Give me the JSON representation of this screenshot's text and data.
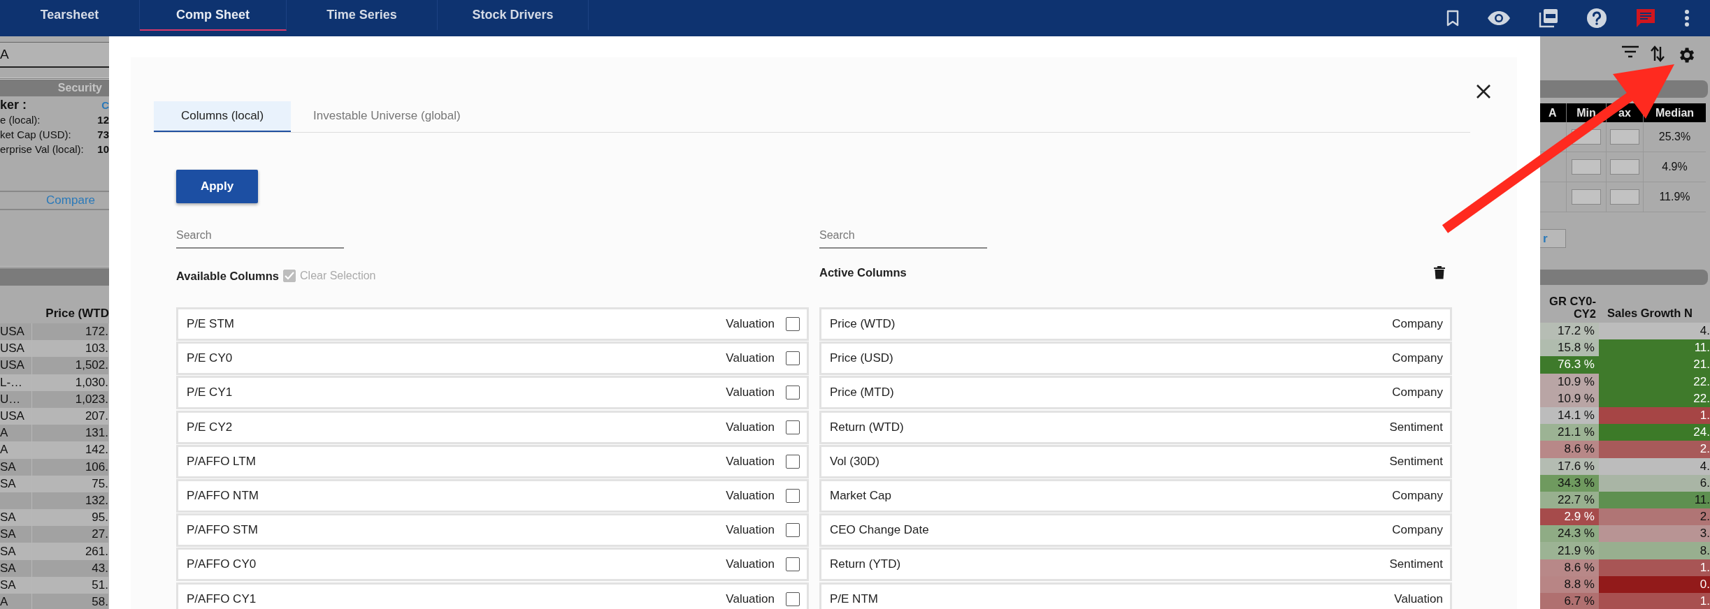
{
  "nav": {
    "tabs": [
      {
        "label": "Tearsheet",
        "selected": false
      },
      {
        "label": "Comp Sheet",
        "selected": true
      },
      {
        "label": "Time Series",
        "selected": false
      },
      {
        "label": "Stock Drivers",
        "selected": false
      }
    ]
  },
  "background_left": {
    "field_value": "A",
    "section_title": "Security",
    "info": [
      {
        "label": "ker :",
        "value": "C",
        "kind": "link"
      },
      {
        "label": "e (local):",
        "value": "12",
        "kind": "plain"
      },
      {
        "label": "ket Cap (USD):",
        "value": "73",
        "kind": "plain"
      },
      {
        "label": "erprise Val (local):",
        "value": "10",
        "kind": "plain"
      }
    ],
    "compare_link": "Compare",
    "column_header": "Price (WTD",
    "rows": [
      [
        "USA",
        "172."
      ],
      [
        "USA",
        "103."
      ],
      [
        "USA",
        "1,502."
      ],
      [
        "L-…",
        "1,030."
      ],
      [
        "U…",
        "1,023."
      ],
      [
        "USA",
        "207."
      ],
      [
        "A",
        "131."
      ],
      [
        "A",
        "142."
      ],
      [
        "SA",
        "106."
      ],
      [
        "SA",
        "75."
      ],
      [
        "",
        "132."
      ],
      [
        "SA",
        "95."
      ],
      [
        "SA",
        "27."
      ],
      [
        "SA",
        "261."
      ],
      [
        "SA",
        "43."
      ],
      [
        "SA",
        "51."
      ],
      [
        "A",
        "58."
      ]
    ]
  },
  "background_right": {
    "stats_columns": [
      "A",
      "Min",
      "ax",
      "Median"
    ],
    "stats_medians": [
      "25.3%",
      "4.9%",
      "11.9%"
    ],
    "button_label": "r",
    "columns": [
      "GR CY0- CY2",
      "Sales Growth N"
    ],
    "rows": [
      {
        "growth": {
          "text": "17.2 %",
          "color": "#b6bdb4"
        },
        "sales": {
          "text": "4.",
          "color": "#bcbcbc"
        }
      },
      {
        "growth": {
          "text": "15.8 %",
          "color": "#b0bcae"
        },
        "sales": {
          "text": "11.",
          "color": "#3f7a2b"
        }
      },
      {
        "growth": {
          "text": "76.3 %",
          "color": "#3e7a2b"
        },
        "sales": {
          "text": "21.",
          "color": "#3f7a2b"
        }
      },
      {
        "growth": {
          "text": "10.9 %",
          "color": "#b9a5a5"
        },
        "sales": {
          "text": "22.",
          "color": "#3f7a2b"
        }
      },
      {
        "growth": {
          "text": "10.9 %",
          "color": "#b9a5a5"
        },
        "sales": {
          "text": "22.",
          "color": "#3f7a2b"
        }
      },
      {
        "growth": {
          "text": "14.1 %",
          "color": "#bcbcbc"
        },
        "sales": {
          "text": "1.",
          "color": "#a64545"
        }
      },
      {
        "growth": {
          "text": "21.1 %",
          "color": "#9cb394"
        },
        "sales": {
          "text": "24.",
          "color": "#3c7a28"
        }
      },
      {
        "growth": {
          "text": "8.6 %",
          "color": "#b88888"
        },
        "sales": {
          "text": "2.",
          "color": "#a85a5a"
        }
      },
      {
        "growth": {
          "text": "17.6 %",
          "color": "#b4bcb2"
        },
        "sales": {
          "text": "4.",
          "color": "#bcbcbc"
        }
      },
      {
        "growth": {
          "text": "34.3 %",
          "color": "#6f9a5f"
        },
        "sales": {
          "text": "6.",
          "color": "#a9b5a5"
        }
      },
      {
        "growth": {
          "text": "22.7 %",
          "color": "#98b08f"
        },
        "sales": {
          "text": "11.",
          "color": "#5e9050"
        }
      },
      {
        "growth": {
          "text": "2.9 %",
          "color": "#a64b4b"
        },
        "sales": {
          "text": "2.",
          "color": "#b07575"
        }
      },
      {
        "growth": {
          "text": "24.3 %",
          "color": "#8fac85"
        },
        "sales": {
          "text": "3.",
          "color": "#b89494"
        }
      },
      {
        "growth": {
          "text": "21.9 %",
          "color": "#9cb394"
        },
        "sales": {
          "text": "8.",
          "color": "#98af8f"
        }
      },
      {
        "growth": {
          "text": "8.6 %",
          "color": "#b88888"
        },
        "sales": {
          "text": "1.",
          "color": "#a85555"
        }
      },
      {
        "growth": {
          "text": "8.8 %",
          "color": "#b88585"
        },
        "sales": {
          "text": "0.",
          "color": "#921a1a"
        }
      },
      {
        "growth": {
          "text": "6.7 %",
          "color": "#b07070"
        },
        "sales": {
          "text": "1.",
          "color": "#a85050"
        }
      }
    ]
  },
  "modal": {
    "tabs": [
      {
        "label": "Columns (local)",
        "selected": true
      },
      {
        "label": "Investable Universe (global)",
        "selected": false
      }
    ],
    "apply_label": "Apply",
    "available": {
      "search_placeholder": "Search",
      "title": "Available Columns",
      "select_all": {
        "checked": true,
        "disabled": true
      },
      "clear_selection": {
        "label": "Clear Selection",
        "disabled": true
      },
      "items": [
        {
          "name": "P/E STM",
          "category": "Valuation",
          "checked": false
        },
        {
          "name": "P/E CY0",
          "category": "Valuation",
          "checked": false
        },
        {
          "name": "P/E CY1",
          "category": "Valuation",
          "checked": false
        },
        {
          "name": "P/E CY2",
          "category": "Valuation",
          "checked": false
        },
        {
          "name": "P/AFFO LTM",
          "category": "Valuation",
          "checked": false
        },
        {
          "name": "P/AFFO NTM",
          "category": "Valuation",
          "checked": false
        },
        {
          "name": "P/AFFO STM",
          "category": "Valuation",
          "checked": false
        },
        {
          "name": "P/AFFO CY0",
          "category": "Valuation",
          "checked": false
        },
        {
          "name": "P/AFFO CY1",
          "category": "Valuation",
          "checked": false
        }
      ]
    },
    "active": {
      "search_placeholder": "Search",
      "title": "Active Columns",
      "items": [
        {
          "name": "Price (WTD)",
          "category": "Company"
        },
        {
          "name": "Price (USD)",
          "category": "Company"
        },
        {
          "name": "Price (MTD)",
          "category": "Company"
        },
        {
          "name": "Return (WTD)",
          "category": "Sentiment"
        },
        {
          "name": "Vol (30D)",
          "category": "Sentiment"
        },
        {
          "name": "Market Cap",
          "category": "Company"
        },
        {
          "name": "CEO Change Date",
          "category": "Company"
        },
        {
          "name": "Return (YTD)",
          "category": "Sentiment"
        },
        {
          "name": "P/E NTM",
          "category": "Valuation"
        }
      ]
    }
  }
}
